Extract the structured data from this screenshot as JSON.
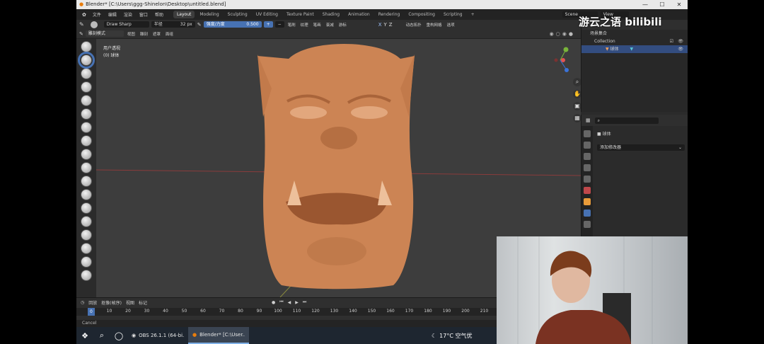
{
  "window": {
    "title": "Blender* [C:\\Users\\ggg-Shinelon\\Desktop\\untitled.blend]",
    "controls": [
      "—",
      "☐",
      "✕"
    ]
  },
  "menu": {
    "items": [
      "文件",
      "编辑",
      "渲染",
      "窗口",
      "帮助"
    ]
  },
  "workspaces": {
    "tabs": [
      "Layout",
      "Modeling",
      "Sculpting",
      "UV Editing",
      "Texture Paint",
      "Shading",
      "Animation",
      "Rendering",
      "Compositing",
      "Scripting",
      "+"
    ],
    "active": "Layout"
  },
  "scene": {
    "name": "Scene",
    "view_layer": "View Layer"
  },
  "tool_header": {
    "brush": "Draw Sharp",
    "radius_label": "半径",
    "radius_value": "32 px",
    "strength_label": "强度/力度",
    "strength_value": "0.500",
    "menus": [
      "笔刷",
      "纹理",
      "笔画",
      "衰减",
      "游标"
    ],
    "right_menus": [
      "动态拓扑",
      "重构网格",
      "选项"
    ]
  },
  "mode_header": {
    "mode": "雕刻模式",
    "menus": [
      "视图",
      "雕刻",
      "遮罩",
      "面组"
    ]
  },
  "viewport": {
    "line1": "用户透视",
    "line2": "(0) 球体",
    "axes": {
      "x": "X",
      "y": "Y",
      "z": "Z"
    }
  },
  "outliner": {
    "root": "场景集合",
    "collection": "Collection",
    "object": "球体"
  },
  "properties": {
    "object_name": "球体",
    "modifier_dropdown": "添加修改器"
  },
  "timeline": {
    "menus": [
      "回放",
      "抠像(帧序)",
      "视图",
      "标记"
    ],
    "ticks": [
      "0",
      "10",
      "20",
      "30",
      "40",
      "50",
      "60",
      "70",
      "80",
      "90",
      "100",
      "110",
      "120",
      "130",
      "140",
      "150",
      "160",
      "170",
      "180",
      "190",
      "200",
      "210"
    ],
    "current_frame": "0"
  },
  "status": {
    "text": "Cancel"
  },
  "taskbar": {
    "apps": [
      {
        "label": "OBS 26.1.1 (64-bi...",
        "active": false
      },
      {
        "label": "Blender* [C:\\User...",
        "active": true
      }
    ],
    "weather": "17°C 空气优"
  },
  "overlay": {
    "watermark": "游云之语 bilibili"
  },
  "colors": {
    "accent": "#4772b3",
    "sculpt": "#d0875a",
    "viewport_bg": "#3d3d3d"
  }
}
